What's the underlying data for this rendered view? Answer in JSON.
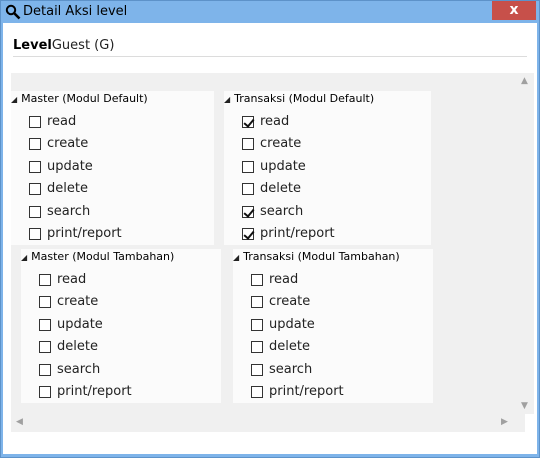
{
  "window": {
    "title": "Detail Aksi level",
    "close_glyph": "x"
  },
  "level": {
    "label": "Level",
    "value": "Guest (G)"
  },
  "groups": [
    {
      "title": "Master (Modul Default)",
      "items": [
        {
          "label": "read",
          "checked": false
        },
        {
          "label": "create",
          "checked": false
        },
        {
          "label": "update",
          "checked": false
        },
        {
          "label": "delete",
          "checked": false
        },
        {
          "label": "search",
          "checked": false
        },
        {
          "label": "print/report",
          "checked": false
        }
      ]
    },
    {
      "title": "Transaksi (Modul Default)",
      "items": [
        {
          "label": "read",
          "checked": true
        },
        {
          "label": "create",
          "checked": false
        },
        {
          "label": "update",
          "checked": false
        },
        {
          "label": "delete",
          "checked": false
        },
        {
          "label": "search",
          "checked": true
        },
        {
          "label": "print/report",
          "checked": true
        }
      ]
    },
    {
      "title": "Master (Modul Tambahan)",
      "items": [
        {
          "label": "read",
          "checked": false
        },
        {
          "label": "create",
          "checked": false
        },
        {
          "label": "update",
          "checked": false
        },
        {
          "label": "delete",
          "checked": false
        },
        {
          "label": "search",
          "checked": false
        },
        {
          "label": "print/report",
          "checked": false
        }
      ]
    },
    {
      "title": "Transaksi (Modul Tambahan)",
      "items": [
        {
          "label": "read",
          "checked": false
        },
        {
          "label": "create",
          "checked": false
        },
        {
          "label": "update",
          "checked": false
        },
        {
          "label": "delete",
          "checked": false
        },
        {
          "label": "search",
          "checked": false
        },
        {
          "label": "print/report",
          "checked": false
        }
      ]
    }
  ]
}
